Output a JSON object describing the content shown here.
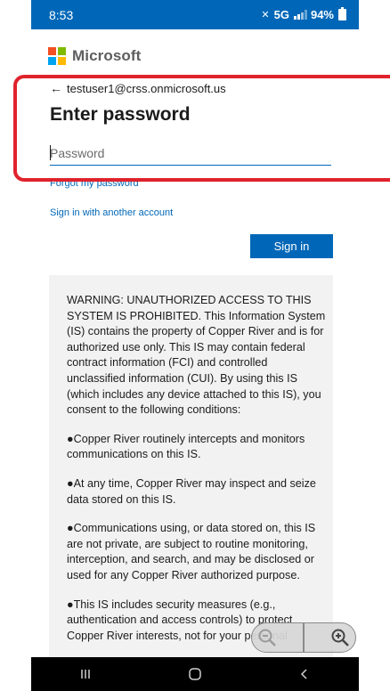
{
  "status_bar": {
    "time": "8:53",
    "network": "5G",
    "battery": "94%"
  },
  "brand": {
    "name": "Microsoft",
    "logo_colors": [
      "#f25022",
      "#7fba00",
      "#00a4ef",
      "#ffb900"
    ]
  },
  "signin": {
    "identity": "testuser1@crss.onmicrosoft.us",
    "title": "Enter password",
    "password_placeholder": "Password",
    "password_value": "",
    "forgot_link": "Forgot my password",
    "other_account_link": "Sign in with another account",
    "submit_label": "Sign in"
  },
  "warning_banner": {
    "paragraphs": [
      "WARNING: UNAUTHORIZED ACCESS TO THIS SYSTEM IS PROHIBITED. This Information System (IS) contains the property of Copper River and is for authorized use only. This IS may contain federal contract information (FCI) and controlled unclassified information (CUI). By using this IS (which includes any device attached to this IS), you consent to the following conditions:",
      "●Copper River routinely intercepts and monitors communications on this IS.",
      "●At any time, Copper River may inspect and seize data stored on this IS.",
      "●Communications using, or data stored on, this IS are not private, are subject to routine monitoring, interception, and search, and may be disclosed or used for any Copper River authorized purpose.",
      "●This IS includes security measures (e.g., authentication and access controls) to protect Copper River interests, not for your personal"
    ]
  },
  "colors": {
    "accent": "#0067b8",
    "highlight": "#e0222c"
  },
  "nav_bar": {
    "items": [
      "recent-apps-icon",
      "home-icon",
      "back-icon"
    ]
  },
  "zoom_control": {
    "items": [
      "zoom-out-icon",
      "zoom-in-icon"
    ]
  }
}
